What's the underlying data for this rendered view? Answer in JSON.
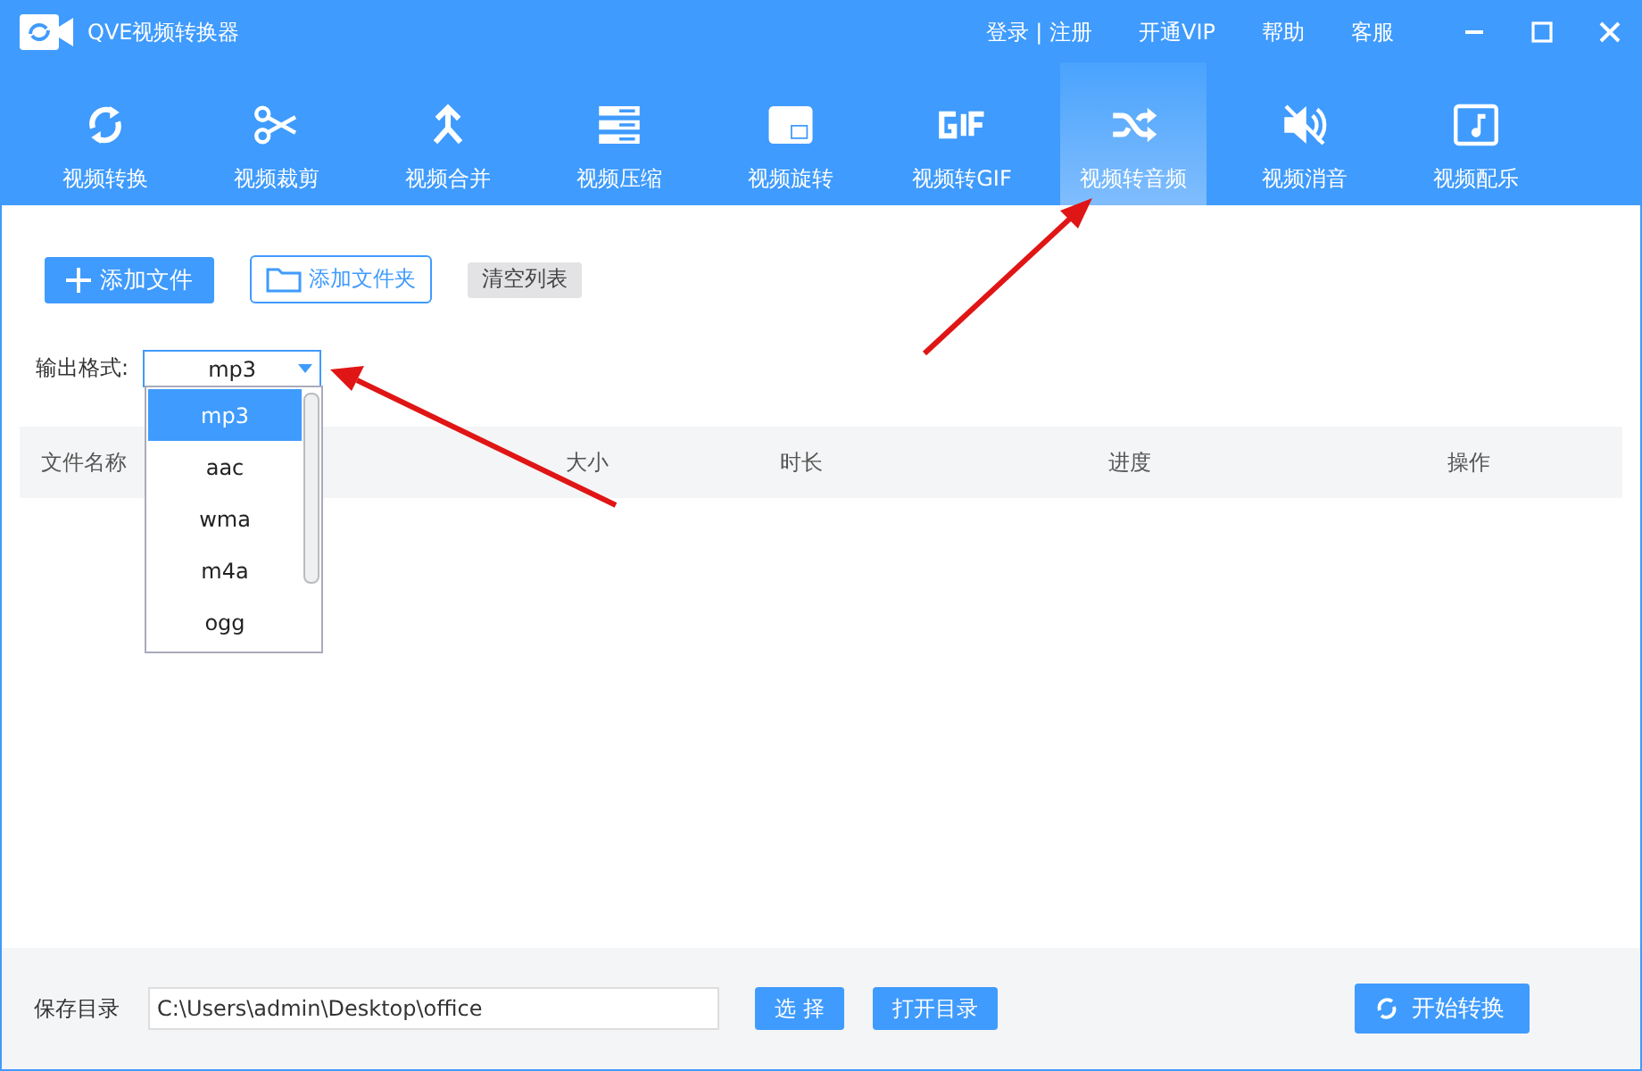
{
  "window": {
    "title": "QVE视频转换器"
  },
  "header_links": [
    "登录 | 注册",
    "开通VIP",
    "帮助",
    "客服"
  ],
  "tabs": [
    {
      "label": "视频转换",
      "selected": false
    },
    {
      "label": "视频裁剪",
      "selected": false
    },
    {
      "label": "视频合并",
      "selected": false
    },
    {
      "label": "视频压缩",
      "selected": false
    },
    {
      "label": "视频旋转",
      "selected": false
    },
    {
      "label": "视频转GIF",
      "selected": false
    },
    {
      "label": "视频转音频",
      "selected": true
    },
    {
      "label": "视频消音",
      "selected": false
    },
    {
      "label": "视频配乐",
      "selected": false
    }
  ],
  "toolbar": {
    "add_file": "添加文件",
    "add_folder": "添加文件夹",
    "clear_list": "清空列表"
  },
  "output_format": {
    "label": "输出格式:",
    "value": "mp3",
    "options": [
      {
        "label": "mp3",
        "selected": true
      },
      {
        "label": "aac",
        "selected": false
      },
      {
        "label": "wma",
        "selected": false
      },
      {
        "label": "m4a",
        "selected": false
      },
      {
        "label": "ogg",
        "selected": false
      }
    ]
  },
  "table": {
    "columns": [
      "文件名称",
      "大小",
      "时长",
      "进度",
      "操作"
    ]
  },
  "footer": {
    "label": "保存目录",
    "path": "C:\\Users\\admin\\Desktop\\office",
    "choose": "选 择",
    "open_dir": "打开目录",
    "start": "开始转换"
  }
}
